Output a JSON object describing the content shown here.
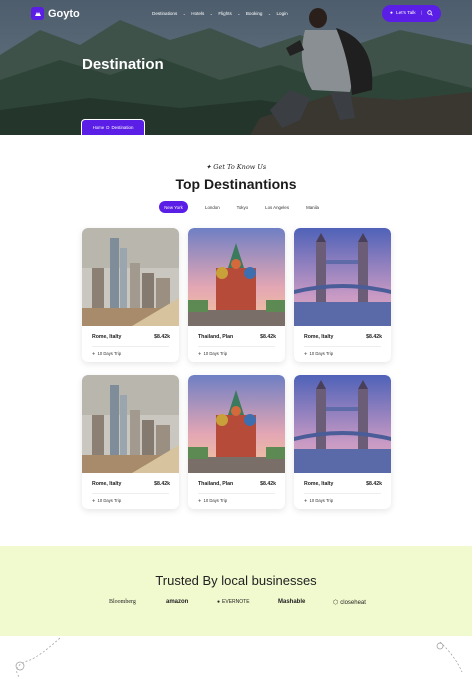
{
  "brand": {
    "name": "Goyto"
  },
  "nav": {
    "items": [
      "Destinations",
      "Hotels",
      "Flights",
      "Booking",
      "Login"
    ],
    "cta_label": "Let's Talk"
  },
  "hero": {
    "title": "Destination"
  },
  "breadcrumb": {
    "home": "Home",
    "separator": "D",
    "current": "Destination"
  },
  "section": {
    "eyebrow": "Get To Know Us",
    "title": "Top Destinantions",
    "tabs": [
      "New York",
      "London",
      "Tokyo",
      "Los Angeles",
      "Manila"
    ],
    "active_tab": "New York"
  },
  "cards": [
    {
      "location": "Rome, Italty",
      "price": "$8.42k",
      "trip": "10 Days Trip",
      "image": "city-skyline"
    },
    {
      "location": "Thailand, Plan",
      "price": "$8.42k",
      "trip": "10 Days Trip",
      "image": "cathedral"
    },
    {
      "location": "Rome, Italty",
      "price": "$8.42k",
      "trip": "10 Days Trip",
      "image": "tower-bridge"
    },
    {
      "location": "Rome, Italty",
      "price": "$8.42k",
      "trip": "10 Days Trip",
      "image": "city-skyline"
    },
    {
      "location": "Thailand, Plan",
      "price": "$8.42k",
      "trip": "10 Days Trip",
      "image": "cathedral"
    },
    {
      "location": "Rome, Italty",
      "price": "$8.42k",
      "trip": "10 Days Trip",
      "image": "tower-bridge"
    }
  ],
  "trusted": {
    "title": "Trusted By local businesses",
    "brands": [
      "Bloomberg",
      "amazon",
      "EVERNOTE",
      "Mashable",
      "closeheat"
    ]
  },
  "colors": {
    "accent": "#5b1ee6",
    "trusted_bg": "#f1f9cf"
  }
}
